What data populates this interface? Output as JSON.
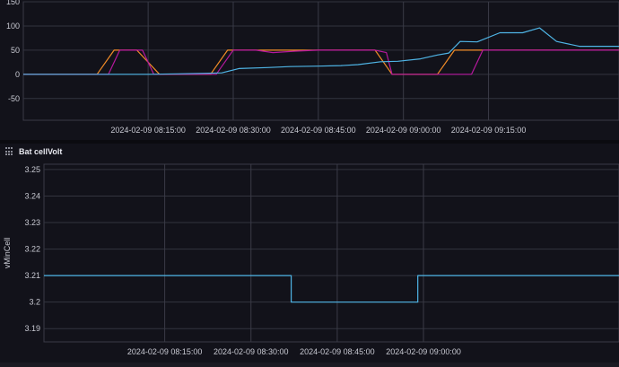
{
  "panels": {
    "top": {
      "title": "",
      "yTicks": [
        "150",
        "100",
        "50",
        "0",
        "-50"
      ],
      "xTicks": [
        "2024-02-09 08:15:00",
        "2024-02-09 08:30:00",
        "2024-02-09 08:45:00",
        "2024-02-09 09:00:00",
        "2024-02-09 09:15:00"
      ]
    },
    "bottom": {
      "title": "Bat cellVolt",
      "ylabel": "vMinCell",
      "yTicks": [
        "3.25",
        "3.24",
        "3.23",
        "3.22",
        "3.21",
        "3.2",
        "3.19"
      ],
      "xTicks": [
        "2024-02-09 08:15:00",
        "2024-02-09 08:30:00",
        "2024-02-09 08:45:00",
        "2024-02-09 09:00:00"
      ]
    }
  },
  "chart_data": [
    {
      "type": "line",
      "title": "",
      "xlabel": "",
      "ylabel": "",
      "ylim": [
        -95,
        150
      ],
      "xlim_minutes_after_0800": [
        -7,
        98
      ],
      "x_labels": [
        "08:15",
        "08:30",
        "08:45",
        "09:00",
        "09:15"
      ],
      "grid": true,
      "series": [
        {
          "color": "#f28c28",
          "points": [
            [
              -7,
              0
            ],
            [
              1,
              0
            ],
            [
              6,
              0
            ],
            [
              9,
              50
            ],
            [
              13,
              50
            ],
            [
              17,
              0
            ],
            [
              20,
              0
            ],
            [
              26,
              0
            ],
            [
              29,
              50
            ],
            [
              35,
              50
            ],
            [
              45,
              50
            ],
            [
              55,
              50
            ],
            [
              58,
              0
            ],
            [
              62,
              0
            ],
            [
              66,
              0
            ],
            [
              69,
              50
            ],
            [
              75,
              50
            ],
            [
              81,
              50
            ],
            [
              86,
              50
            ],
            [
              98,
              50
            ]
          ]
        },
        {
          "color": "#b6189e",
          "points": [
            [
              -7,
              0
            ],
            [
              8,
              0
            ],
            [
              10,
              50
            ],
            [
              14,
              50
            ],
            [
              16,
              0
            ],
            [
              25,
              0
            ],
            [
              27,
              0
            ],
            [
              30,
              50
            ],
            [
              34,
              50
            ],
            [
              37,
              45
            ],
            [
              41,
              48
            ],
            [
              45,
              50
            ],
            [
              50,
              50
            ],
            [
              55,
              50
            ],
            [
              57,
              45
            ],
            [
              58,
              0
            ],
            [
              67,
              0
            ],
            [
              72,
              0
            ],
            [
              74,
              50
            ],
            [
              80,
              50
            ],
            [
              83,
              50
            ],
            [
              98,
              50
            ]
          ]
        },
        {
          "color": "#4fb5e6",
          "points": [
            [
              -7,
              0
            ],
            [
              1,
              0
            ],
            [
              5,
              0
            ],
            [
              10,
              0
            ],
            [
              15,
              0
            ],
            [
              20,
              1
            ],
            [
              25,
              2
            ],
            [
              28,
              3
            ],
            [
              31,
              12
            ],
            [
              36,
              14
            ],
            [
              40,
              16
            ],
            [
              45,
              17
            ],
            [
              49,
              18
            ],
            [
              52,
              20
            ],
            [
              56,
              26
            ],
            [
              59,
              27
            ],
            [
              63,
              32
            ],
            [
              66,
              40
            ],
            [
              68,
              44
            ],
            [
              70,
              68
            ],
            [
              73,
              67
            ],
            [
              77,
              86
            ],
            [
              81,
              86
            ],
            [
              84,
              96
            ],
            [
              87,
              68
            ],
            [
              91,
              58
            ],
            [
              98,
              58
            ]
          ]
        }
      ]
    },
    {
      "type": "line",
      "title": "Bat cellVolt",
      "xlabel": "",
      "ylabel": "vMinCell",
      "ylim": [
        3.185,
        3.252
      ],
      "xlim_minutes_after_0800": [
        -6,
        94
      ],
      "x_labels": [
        "08:15",
        "08:30",
        "08:45",
        "09:00"
      ],
      "grid": true,
      "series": [
        {
          "color": "#4fb5e6",
          "step": true,
          "points": [
            [
              -6,
              3.21
            ],
            [
              37,
              3.21
            ],
            [
              37,
              3.2
            ],
            [
              59,
              3.2
            ],
            [
              59,
              3.21
            ],
            [
              94,
              3.21
            ]
          ]
        }
      ]
    }
  ]
}
